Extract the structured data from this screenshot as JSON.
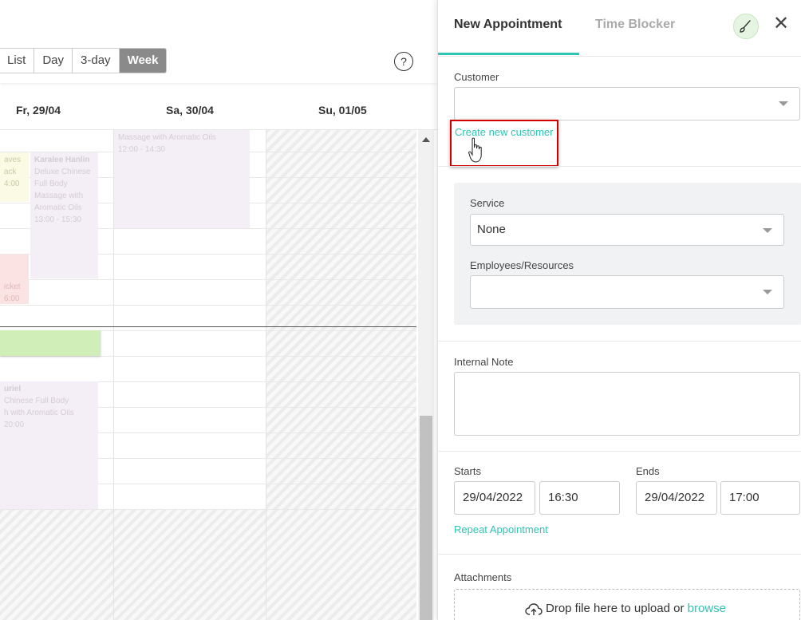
{
  "calendar": {
    "views": [
      "List",
      "Day",
      "3-day",
      "Week"
    ],
    "active_view": "Week",
    "help_label": "?",
    "day_headers": [
      "Fr, 29/04",
      "Sa, 30/04",
      "Su, 01/05"
    ],
    "events": [
      {
        "line1": "Massage with Aromatic Oils",
        "line2": "12:00 - 14:30"
      },
      {
        "line1": "aves",
        "line2": "ack",
        "line3": "4:00"
      },
      {
        "title": "Karalee Hanlin",
        "line1": "Deluxe Chinese",
        "line2": "Full Body",
        "line3": "Massage with",
        "line4": "Aromatic Oils",
        "line5": "13:00 - 15:30"
      },
      {
        "line1": "icket",
        "line2": "6:00"
      },
      {
        "title": "uriel",
        "line1": "Chinese Full Body",
        "line2": "h with Aromatic Oils",
        "line3": "20:00"
      }
    ]
  },
  "panel": {
    "tabs": [
      "New Appointment",
      "Time Blocker"
    ],
    "active_tab": "New Appointment",
    "close_glyph": "✕",
    "customer": {
      "label": "Customer",
      "value": "",
      "create_link": "Create new customer"
    },
    "service": {
      "label": "Service",
      "value": "None"
    },
    "employees": {
      "label": "Employees/Resources",
      "value": ""
    },
    "internal_note": {
      "label": "Internal Note",
      "value": ""
    },
    "starts": {
      "label": "Starts",
      "date": "29/04/2022",
      "time": "16:30"
    },
    "ends": {
      "label": "Ends",
      "date": "29/04/2022",
      "time": "17:00"
    },
    "repeat_link": "Repeat Appointment",
    "attachments": {
      "label": "Attachments",
      "drop_text": "Drop file here to upload or",
      "browse": "browse"
    }
  },
  "colors": {
    "accent": "#2ec4b6",
    "highlight": "#d40000",
    "active_view_bg": "#8a8a8a"
  }
}
